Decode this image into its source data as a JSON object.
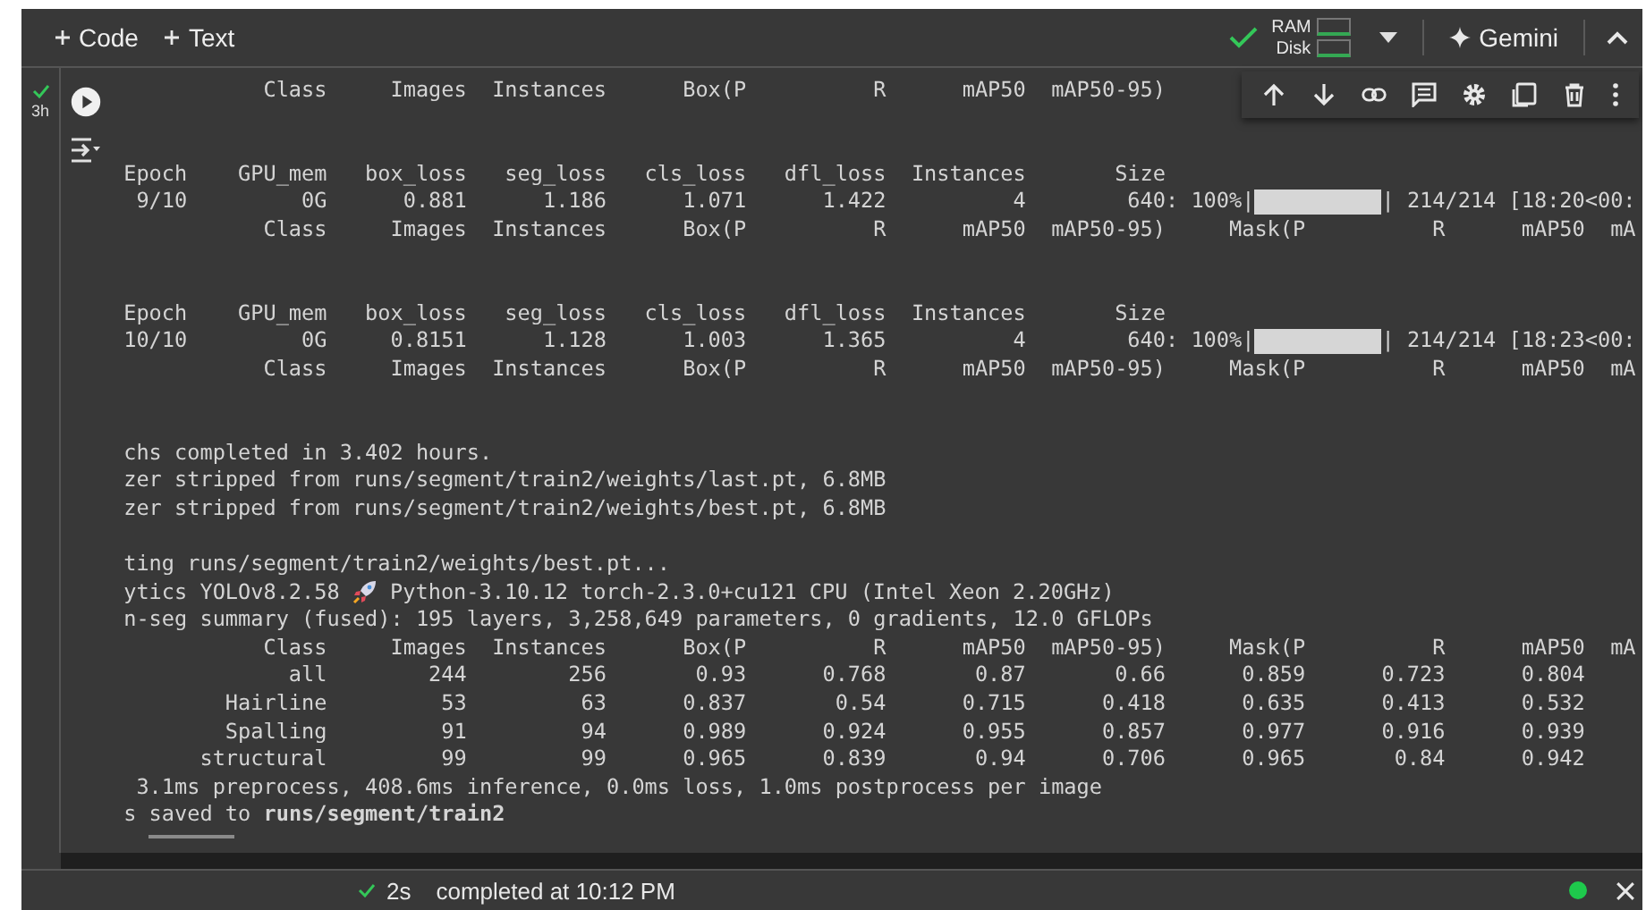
{
  "toolbar": {
    "add_buttons": [
      "Code",
      "Text"
    ],
    "ram_label": "RAM",
    "disk_label": "Disk",
    "gemini": "Gemini"
  },
  "cell": {
    "elapsed": "3h"
  },
  "output": {
    "lines": [
      {
        "kind": "text",
        "text": "            Class     Images  Instances      Box(P          R      mAP50  mAP50-95)"
      },
      {
        "kind": "blank"
      },
      {
        "kind": "blank"
      },
      {
        "kind": "text",
        "text": " Epoch    GPU_mem   box_loss   seg_loss   cls_loss   dfl_loss  Instances       Size"
      },
      {
        "kind": "progress",
        "before": "  9/10         0G      0.881      1.186      1.071      1.422          4        640: 100%|",
        "level": 1,
        "after": "| 214/214 [18:20<00:"
      },
      {
        "kind": "text",
        "text": "            Class     Images  Instances      Box(P          R      mAP50  mAP50-95)     Mask(P          R      mAP50  mA"
      },
      {
        "kind": "blank"
      },
      {
        "kind": "blank"
      },
      {
        "kind": "text",
        "text": " Epoch    GPU_mem   box_loss   seg_loss   cls_loss   dfl_loss  Instances       Size"
      },
      {
        "kind": "progress",
        "before": " 10/10         0G     0.8151      1.128      1.003      1.365          4        640: 100%|",
        "level": 1,
        "after": "| 214/214 [18:23<00:"
      },
      {
        "kind": "text",
        "text": "            Class     Images  Instances      Box(P          R      mAP50  mAP50-95)     Mask(P          R      mAP50  mA"
      },
      {
        "kind": "blank"
      },
      {
        "kind": "blank"
      },
      {
        "kind": "text",
        "text": " chs completed in 3.402 hours."
      },
      {
        "kind": "text",
        "text": " zer stripped from runs/segment/train2/weights/last.pt, 6.8MB"
      },
      {
        "kind": "text",
        "text": " zer stripped from runs/segment/train2/weights/best.pt, 6.8MB"
      },
      {
        "kind": "blank"
      },
      {
        "kind": "text",
        "text": " ting runs/segment/train2/weights/best.pt..."
      },
      {
        "kind": "rocket",
        "before": " ytics YOLOv8.2.58",
        "after": "Python-3.10.12 torch-2.3.0+cu121 CPU (Intel Xeon 2.20GHz)"
      },
      {
        "kind": "text",
        "text": " n-seg summary (fused): 195 layers, 3,258,649 parameters, 0 gradients, 12.0 GFLOPs"
      },
      {
        "kind": "text",
        "text": "            Class     Images  Instances      Box(P          R      mAP50  mAP50-95)     Mask(P          R      mAP50  mA"
      },
      {
        "kind": "text",
        "text": "              all        244        256       0.93      0.768       0.87       0.66      0.859      0.723      0.804"
      },
      {
        "kind": "text",
        "text": "         Hairline         53         63      0.837       0.54      0.715      0.418      0.635      0.413      0.532"
      },
      {
        "kind": "text",
        "text": "         Spalling         91         94      0.989      0.924      0.955      0.857      0.977      0.916      0.939"
      },
      {
        "kind": "text",
        "text": "       structural         99         99      0.965      0.839       0.94      0.706      0.965       0.84      0.942"
      },
      {
        "kind": "text",
        "text": "  3.1ms preprocess, 408.6ms inference, 0.0ms loss, 1.0ms postprocess per image"
      },
      {
        "kind": "rich",
        "text": " s saved to **runs/segment/train2**"
      }
    ]
  },
  "status_bar": {
    "duration": "2s",
    "message": "completed at 10:12 PM"
  }
}
